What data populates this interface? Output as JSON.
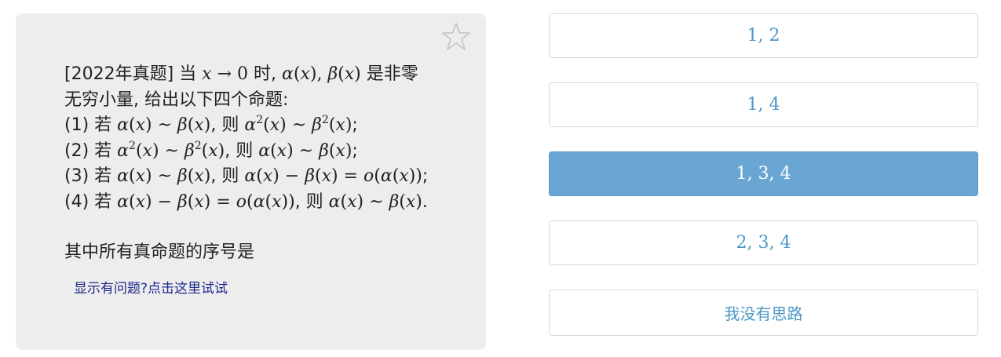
{
  "question": {
    "source_tag": "[2022年真题]",
    "lines": [
      {
        "pre": "当 ",
        "m1": "x → 0",
        "mid": " 时, ",
        "m2": "α(x), β(x)",
        "post": " 是非零"
      },
      {
        "text": "无穷小量, 给出以下四个命题:"
      }
    ],
    "statements": [
      {
        "num": "(1) 若 ",
        "cond": "α(x) ~ β(x)",
        "then": ", 则 ",
        "res": "α²(x) ~ β²(x)",
        "end": ";"
      },
      {
        "num": "(2) 若 ",
        "cond": "α²(x) ~ β²(x)",
        "then": ", 则 ",
        "res": "α(x) ~ β(x)",
        "end": ";"
      },
      {
        "num": "(3) 若 ",
        "cond": "α(x) ~ β(x)",
        "then": ", 则 ",
        "res": "α(x) − β(x) = o(α(x))",
        "end": ";"
      },
      {
        "num": "(4) 若 ",
        "cond": "α(x) − β(x) = o(α(x))",
        "then": ", 则 ",
        "res": "α(x) ~ β(x)",
        "end": "."
      }
    ],
    "prompt": "其中所有真命题的序号是",
    "report_link": "显示有问题?点击这里试试",
    "favorite_icon": "star-outline-icon"
  },
  "options": [
    {
      "label": "1, 2",
      "selected": false
    },
    {
      "label": "1, 4",
      "selected": false
    },
    {
      "label": "1, 3, 4",
      "selected": true
    },
    {
      "label": "2, 3, 4",
      "selected": false
    },
    {
      "label": "我没有思路",
      "selected": false
    }
  ],
  "colors": {
    "card_bg": "#ededed",
    "option_text": "#4c97c6",
    "option_selected_bg": "#6aa6d4",
    "link": "#1e2a8c"
  }
}
